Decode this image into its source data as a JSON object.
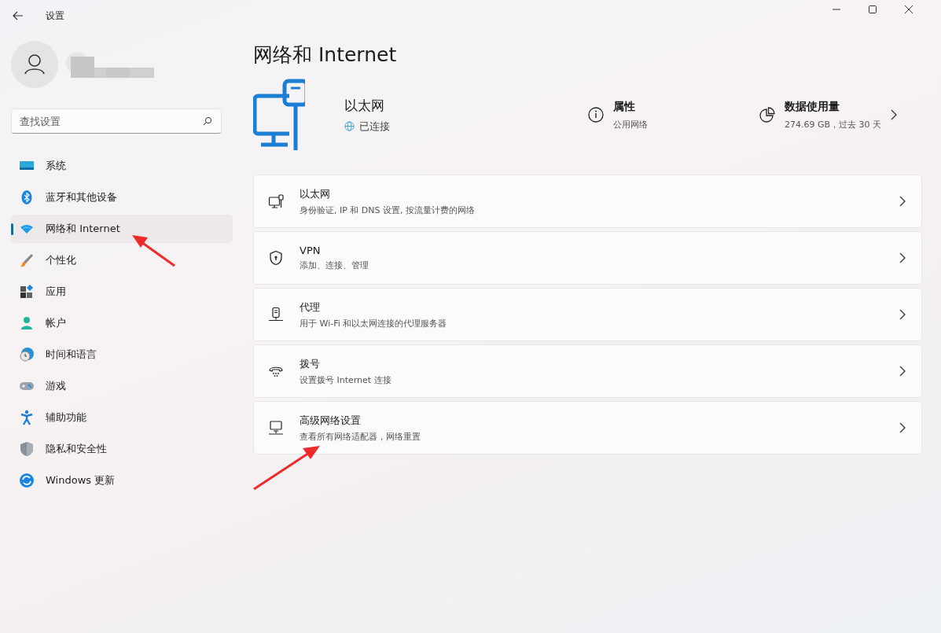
{
  "window": {
    "title": "设置"
  },
  "search": {
    "placeholder": "查找设置"
  },
  "sidebar": {
    "items": [
      {
        "label": "系统",
        "selected": false
      },
      {
        "label": "蓝牙和其他设备",
        "selected": false
      },
      {
        "label": "网络和 Internet",
        "selected": true
      },
      {
        "label": "个性化",
        "selected": false
      },
      {
        "label": "应用",
        "selected": false
      },
      {
        "label": "帐户",
        "selected": false
      },
      {
        "label": "时间和语言",
        "selected": false
      },
      {
        "label": "游戏",
        "selected": false
      },
      {
        "label": "辅助功能",
        "selected": false
      },
      {
        "label": "隐私和安全性",
        "selected": false
      },
      {
        "label": "Windows 更新",
        "selected": false
      }
    ]
  },
  "page_title": "网络和 Internet",
  "connection": {
    "name": "以太网",
    "status": "已连接",
    "properties": {
      "title": "属性",
      "value": "公用网络"
    },
    "data_usage": {
      "title": "数据使用量",
      "value": "274.69 GB，过去 30 天"
    }
  },
  "cards": [
    {
      "title": "以太网",
      "subtitle": "身份验证, IP 和 DNS 设置, 按流量计费的网络"
    },
    {
      "title": "VPN",
      "subtitle": "添加、连接、管理"
    },
    {
      "title": "代理",
      "subtitle": "用于 Wi-Fi 和以太网连接的代理服务器"
    },
    {
      "title": "拨号",
      "subtitle": "设置拨号 Internet 连接"
    },
    {
      "title": "高级网络设置",
      "subtitle": "查看所有网络适配器，网络重置"
    }
  ]
}
